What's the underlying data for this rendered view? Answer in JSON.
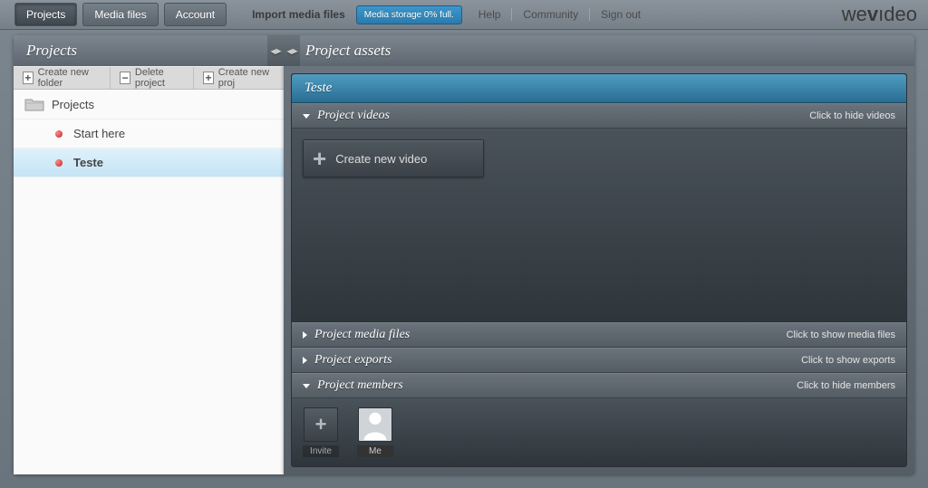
{
  "topbar": {
    "tabs": {
      "projects": "Projects",
      "media": "Media files",
      "account": "Account"
    },
    "import": "Import media files",
    "storage": "Media storage 0% full.",
    "links": {
      "help": "Help",
      "community": "Community",
      "signout": "Sign out"
    },
    "logo_pre": "we",
    "logo_mid": "v",
    "logo_post": "deo"
  },
  "left": {
    "title": "Projects",
    "toolbar": {
      "create_folder": "Create new folder",
      "delete_project": "Delete project",
      "create_project": "Create new proj"
    },
    "root": "Projects",
    "items": [
      "Start here",
      "Teste"
    ]
  },
  "right": {
    "title": "Project assets",
    "project_name": "Teste",
    "videos": {
      "title": "Project videos",
      "hint": "Click to hide videos",
      "create": "Create new video"
    },
    "media": {
      "title": "Project media files",
      "hint": "Click to show media files"
    },
    "exports": {
      "title": "Project exports",
      "hint": "Click to show exports"
    },
    "members": {
      "title": "Project members",
      "hint": "Click to hide members",
      "invite": "Invite",
      "me": "Me"
    }
  }
}
